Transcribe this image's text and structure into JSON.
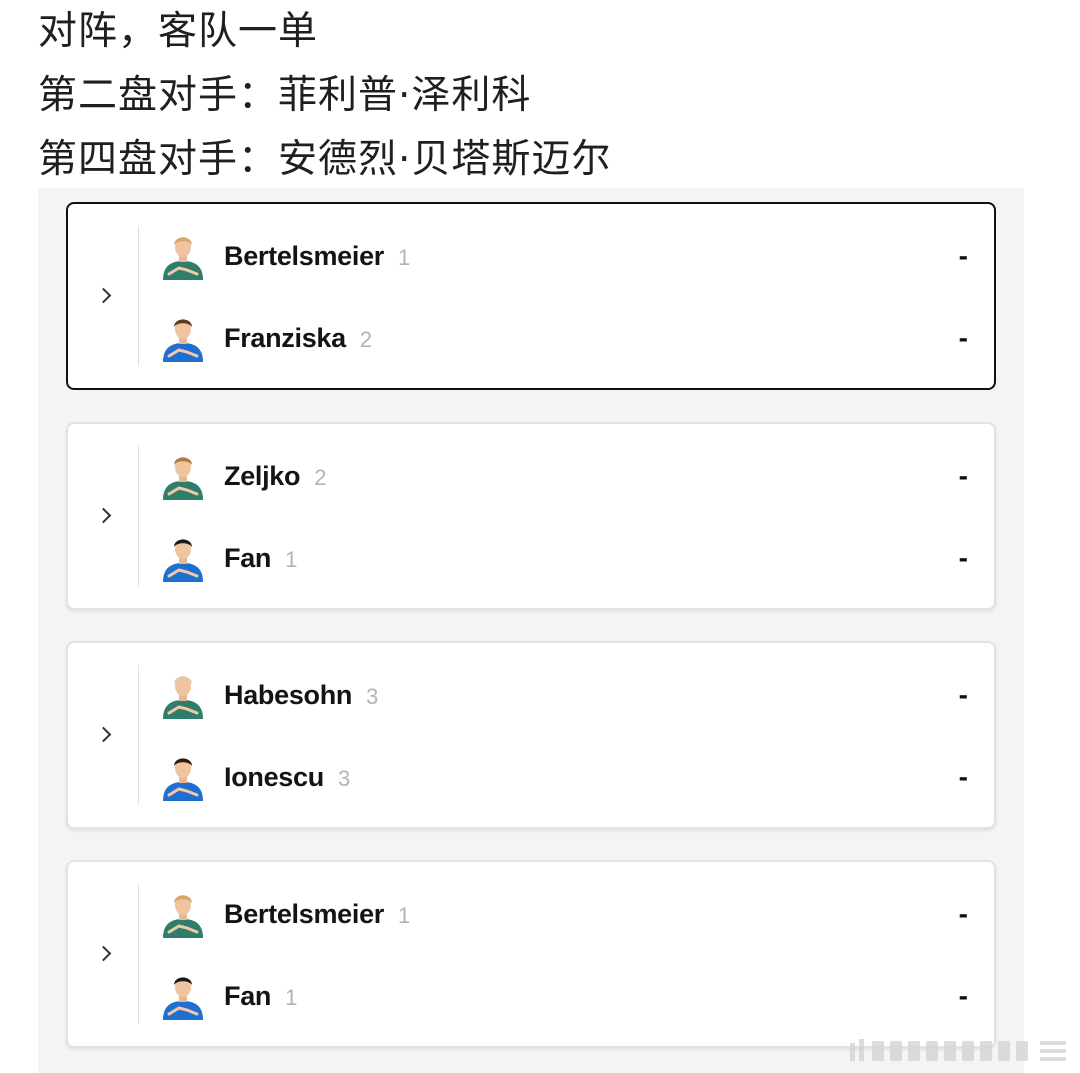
{
  "heading": {
    "lines": [
      "对阵，客队一单",
      "第二盘对手：菲利普·泽利科",
      "第四盘对手：安德烈·贝塔斯迈尔"
    ]
  },
  "matches": [
    {
      "selected": true,
      "home": {
        "name": "Bertelsmeier",
        "seed": "1",
        "score": "-",
        "team_color": "#2f7d6b",
        "hair": "#d6a66a"
      },
      "away": {
        "name": "Franziska",
        "seed": "2",
        "score": "-",
        "team_color": "#1f6fd1",
        "hair": "#5a3a22"
      }
    },
    {
      "selected": false,
      "home": {
        "name": "Zeljko",
        "seed": "2",
        "score": "-",
        "team_color": "#2f7d6b",
        "hair": "#b07a45"
      },
      "away": {
        "name": "Fan",
        "seed": "1",
        "score": "-",
        "team_color": "#1f6fd1",
        "hair": "#1a1a1a"
      }
    },
    {
      "selected": false,
      "home": {
        "name": "Habesohn",
        "seed": "3",
        "score": "-",
        "team_color": "#2f7d6b",
        "hair": "#e0c9a6"
      },
      "away": {
        "name": "Ionescu",
        "seed": "3",
        "score": "-",
        "team_color": "#1f6fd1",
        "hair": "#2a1a10"
      }
    },
    {
      "selected": false,
      "home": {
        "name": "Bertelsmeier",
        "seed": "1",
        "score": "-",
        "team_color": "#2f7d6b",
        "hair": "#d6a66a"
      },
      "away": {
        "name": "Fan",
        "seed": "1",
        "score": "-",
        "team_color": "#1f6fd1",
        "hair": "#1a1a1a"
      }
    }
  ],
  "icons": {
    "expand": "chevron-right-icon",
    "avatar": "player-avatar-icon"
  }
}
